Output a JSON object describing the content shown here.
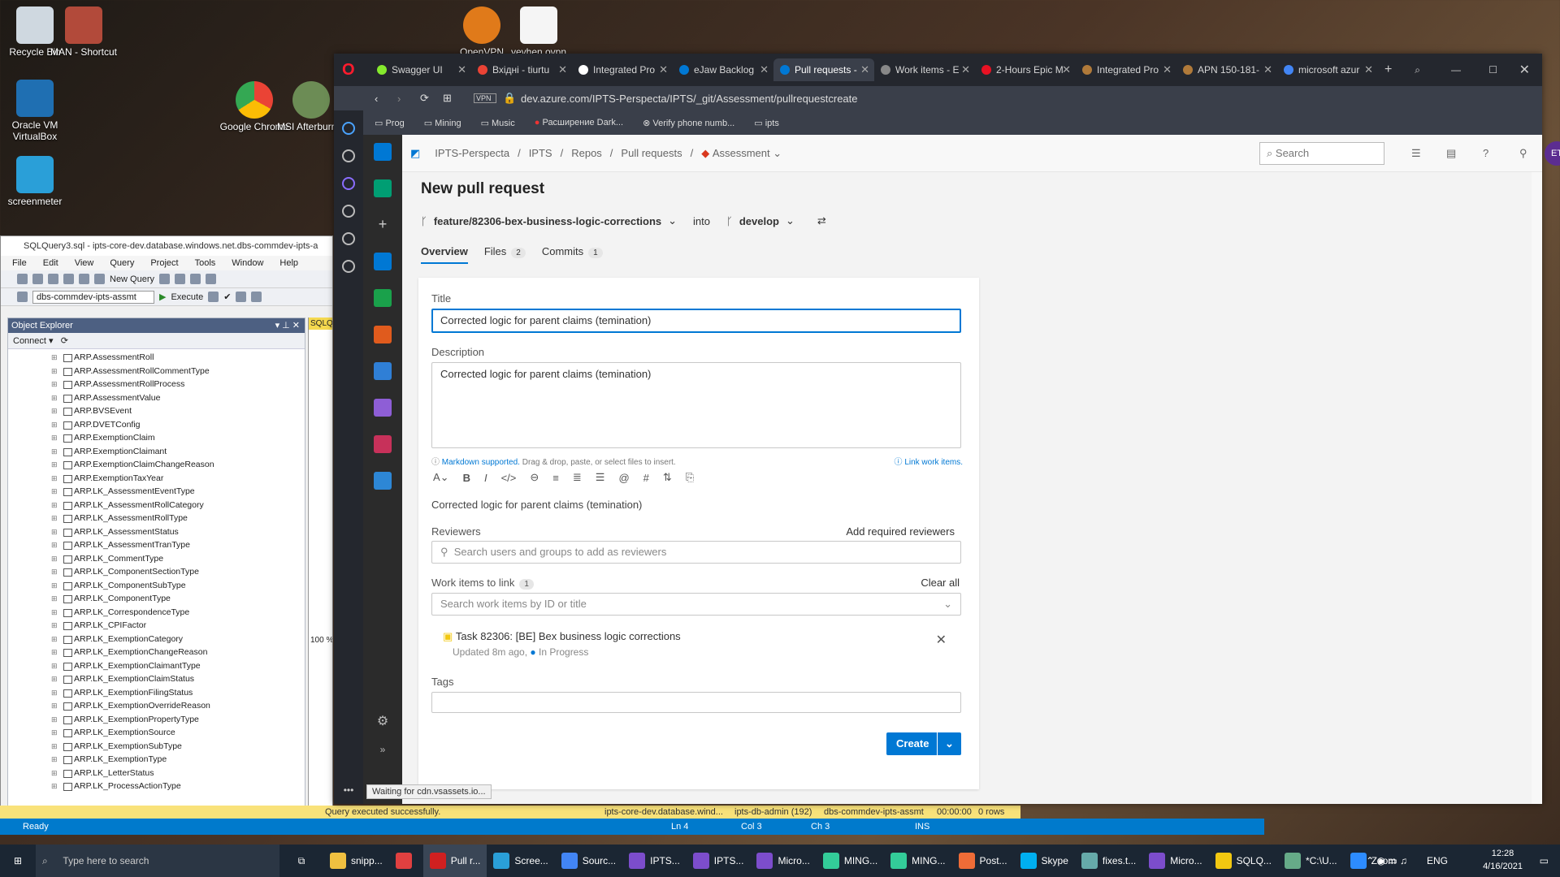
{
  "desktop_icons": [
    {
      "label": "Recycle Bin"
    },
    {
      "label": "MAN - Shortcut"
    },
    {
      "label": "OpenVPN"
    },
    {
      "label": "yevhen.ovpn"
    },
    {
      "label": "Oracle VM VirtualBox"
    },
    {
      "label": "Google Chrome"
    },
    {
      "label": "MSI Afterburner"
    },
    {
      "label": "screenmeter"
    }
  ],
  "ssms": {
    "title": "SQLQuery3.sql - ipts-core-dev.database.windows.net.dbs-commdev-ipts-a",
    "menu": [
      "File",
      "Edit",
      "View",
      "Query",
      "Project",
      "Tools",
      "Window",
      "Help"
    ],
    "toolbar_new_query": "New Query",
    "db_select": "dbs-commdev-ipts-assmt",
    "execute": "Execute",
    "object_explorer_title": "Object Explorer",
    "connect": "Connect",
    "tables": [
      "ARP.AssessmentRoll",
      "ARP.AssessmentRollCommentType",
      "ARP.AssessmentRollProcess",
      "ARP.AssessmentValue",
      "ARP.BVSEvent",
      "ARP.DVETConfig",
      "ARP.ExemptionClaim",
      "ARP.ExemptionClaimant",
      "ARP.ExemptionClaimChangeReason",
      "ARP.ExemptionTaxYear",
      "ARP.LK_AssessmentEventType",
      "ARP.LK_AssessmentRollCategory",
      "ARP.LK_AssessmentRollType",
      "ARP.LK_AssessmentStatus",
      "ARP.LK_AssessmentTranType",
      "ARP.LK_CommentType",
      "ARP.LK_ComponentSectionType",
      "ARP.LK_ComponentSubType",
      "ARP.LK_ComponentType",
      "ARP.LK_CorrespondenceType",
      "ARP.LK_CPIFactor",
      "ARP.LK_ExemptionCategory",
      "ARP.LK_ExemptionChangeReason",
      "ARP.LK_ExemptionClaimantType",
      "ARP.LK_ExemptionClaimStatus",
      "ARP.LK_ExemptionFilingStatus",
      "ARP.LK_ExemptionOverrideReason",
      "ARP.LK_ExemptionPropertyType",
      "ARP.LK_ExemptionSource",
      "ARP.LK_ExemptionSubType",
      "ARP.LK_ExemptionType",
      "ARP.LK_LetterStatus",
      "ARP.LK_ProcessActionType"
    ],
    "query_tab": "SQLQ",
    "zoom": "100 %",
    "result_msg": "Query executed successfully.",
    "server": "ipts-core-dev.database.wind...",
    "user": "ipts-db-admin (192)",
    "db": "dbs-commdev-ipts-assmt",
    "time": "00:00:00",
    "rows": "0 rows",
    "status": "Ready",
    "ln": "Ln 4",
    "col": "Col 3",
    "ch": "Ch 3",
    "ins": "INS"
  },
  "browser": {
    "tabs": [
      {
        "label": "Swagger UI",
        "color": "#85ea2d"
      },
      {
        "label": "Вхідні - tiurtu",
        "color": "#ea4335"
      },
      {
        "label": "Integrated Pro",
        "color": "#ffffff"
      },
      {
        "label": "eJaw Backlog",
        "color": "#0078d4"
      },
      {
        "label": "Pull requests -",
        "color": "#0078d4"
      },
      {
        "label": "Work items - E",
        "color": "#888888"
      },
      {
        "label": "2-Hours Epic M",
        "color": "#e81123"
      },
      {
        "label": "Integrated Pro",
        "color": "#b07a3a"
      },
      {
        "label": "APN 150-181-",
        "color": "#b07a3a"
      },
      {
        "label": "microsoft azur",
        "color": "#4285f4"
      }
    ],
    "url": "dev.azure.com/IPTS-Perspecta/IPTS/_git/Assessment/pullrequestcreate",
    "bookmarks": [
      "Prog",
      "Mining",
      "Music",
      "Расширение Dark...",
      "Verify phone numb...",
      "ipts"
    ],
    "status_tooltip": "Waiting for cdn.vsassets.io..."
  },
  "ado": {
    "breadcrumb": [
      "IPTS-Perspecta",
      "IPTS",
      "Repos",
      "Pull requests",
      "Assessment"
    ],
    "search_placeholder": "Search",
    "avatar": "ET",
    "page_title": "New pull request",
    "source_branch": "feature/82306-bex-business-logic-corrections",
    "into": "into",
    "target_branch": "develop",
    "tabs": [
      {
        "label": "Overview"
      },
      {
        "label": "Files",
        "count": "2"
      },
      {
        "label": "Commits",
        "count": "1"
      }
    ],
    "title_label": "Title",
    "title_value": "Corrected logic for parent claims (temination)",
    "description_label": "Description",
    "description_value": "Corrected logic for parent claims (temination)",
    "markdown_note": "Markdown supported.",
    "markdown_rest": "Drag & drop, paste, or select files to insert.",
    "link_work_items": "Link work items.",
    "preview": "Corrected logic for parent claims (temination)",
    "reviewers_label": "Reviewers",
    "add_required": "Add required reviewers",
    "reviewers_placeholder": "Search users and groups to add as reviewers",
    "work_items_label": "Work items to link",
    "work_items_count": "1",
    "clear_all": "Clear all",
    "work_items_placeholder": "Search work items by ID or title",
    "task_title": "Task 82306: [BE] Bex business logic corrections",
    "task_updated": "Updated 8m ago,",
    "task_state": "In Progress",
    "tags_label": "Tags",
    "create": "Create"
  },
  "taskbar": {
    "search": "Type here to search",
    "items": [
      "snipp...",
      "",
      "Pull r...",
      "Scree...",
      "Sourc...",
      "IPTS...",
      "IPTS...",
      "Micro...",
      "MING...",
      "MING...",
      "Post...",
      "Skype",
      "fixes.t...",
      "Micro...",
      "SQLQ...",
      "*C:\\U...",
      "Zoom"
    ],
    "lang": "ENG",
    "time": "12:28",
    "date": "4/16/2021"
  }
}
